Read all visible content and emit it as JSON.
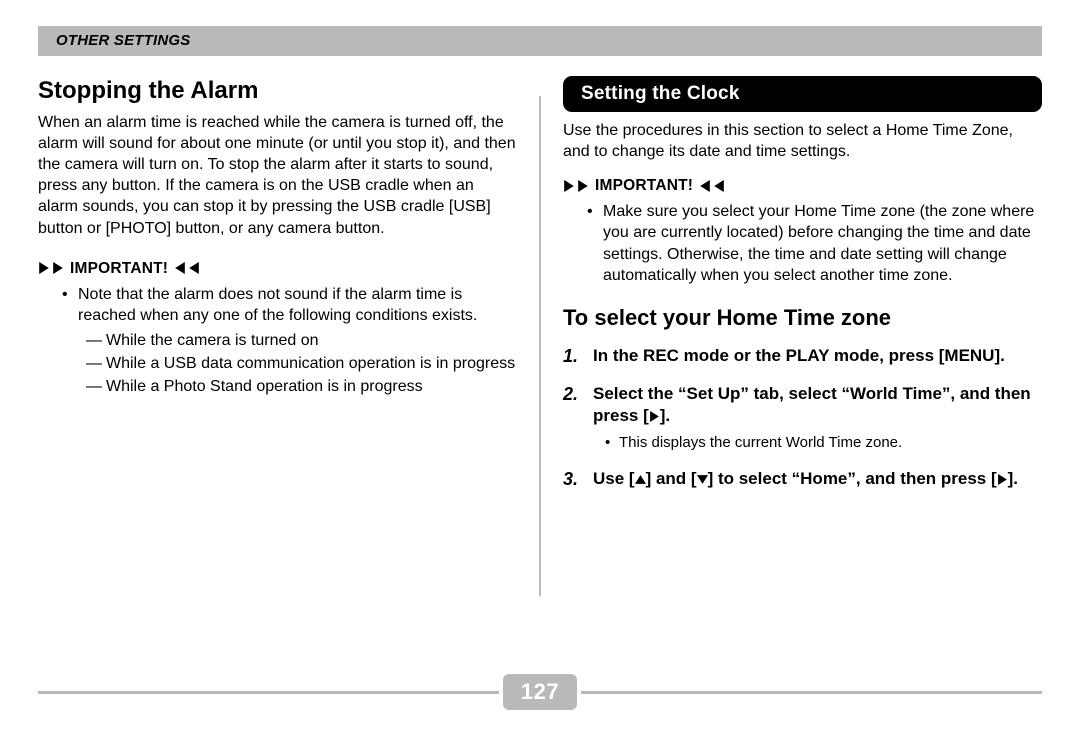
{
  "header": {
    "section_label": "OTHER SETTINGS"
  },
  "left": {
    "heading": "Stopping the Alarm",
    "paragraph": "When an alarm time is reached while the camera is turned off, the alarm will sound for about one minute (or until you stop it), and then the camera will turn on. To stop the alarm after it starts to sound, press any button. If the camera is on the USB cradle when an alarm sounds, you can stop it by pressing the USB cradle [USB] button or [PHOTO] button, or any camera button.",
    "important_label": "IMPORTANT!",
    "note_intro": "Note that the alarm does not sound if the alarm time is reached when any one of the following conditions exists.",
    "conditions": [
      "While the camera is turned on",
      "While a USB data communication operation is in progress",
      "While a Photo Stand operation is in progress"
    ]
  },
  "right": {
    "pill_heading": "Setting the Clock",
    "intro": "Use the procedures in this section to select a Home Time Zone, and to change its date and time settings.",
    "important_label": "IMPORTANT!",
    "note": "Make sure you select your Home Time zone (the zone where you are currently located) before changing the time and date settings. Otherwise, the time and date setting will change automatically when you select another time zone.",
    "sub_heading": "To select your Home Time zone",
    "steps": [
      {
        "text_a": "In the REC mode or the PLAY mode, press [MENU].",
        "sub": null
      },
      {
        "text_a": "Select the “Set Up” tab, select “World Time”, and then press [",
        "text_b": "].",
        "arrow": "right",
        "sub": "This displays the current World Time zone."
      },
      {
        "text_a": "Use [",
        "arrow1": "up",
        "text_b": "] and [",
        "arrow2": "down",
        "text_c": "] to select “Home”, and then press [",
        "arrow3": "right",
        "text_d": "].",
        "sub": null
      }
    ]
  },
  "footer": {
    "page": "127"
  }
}
